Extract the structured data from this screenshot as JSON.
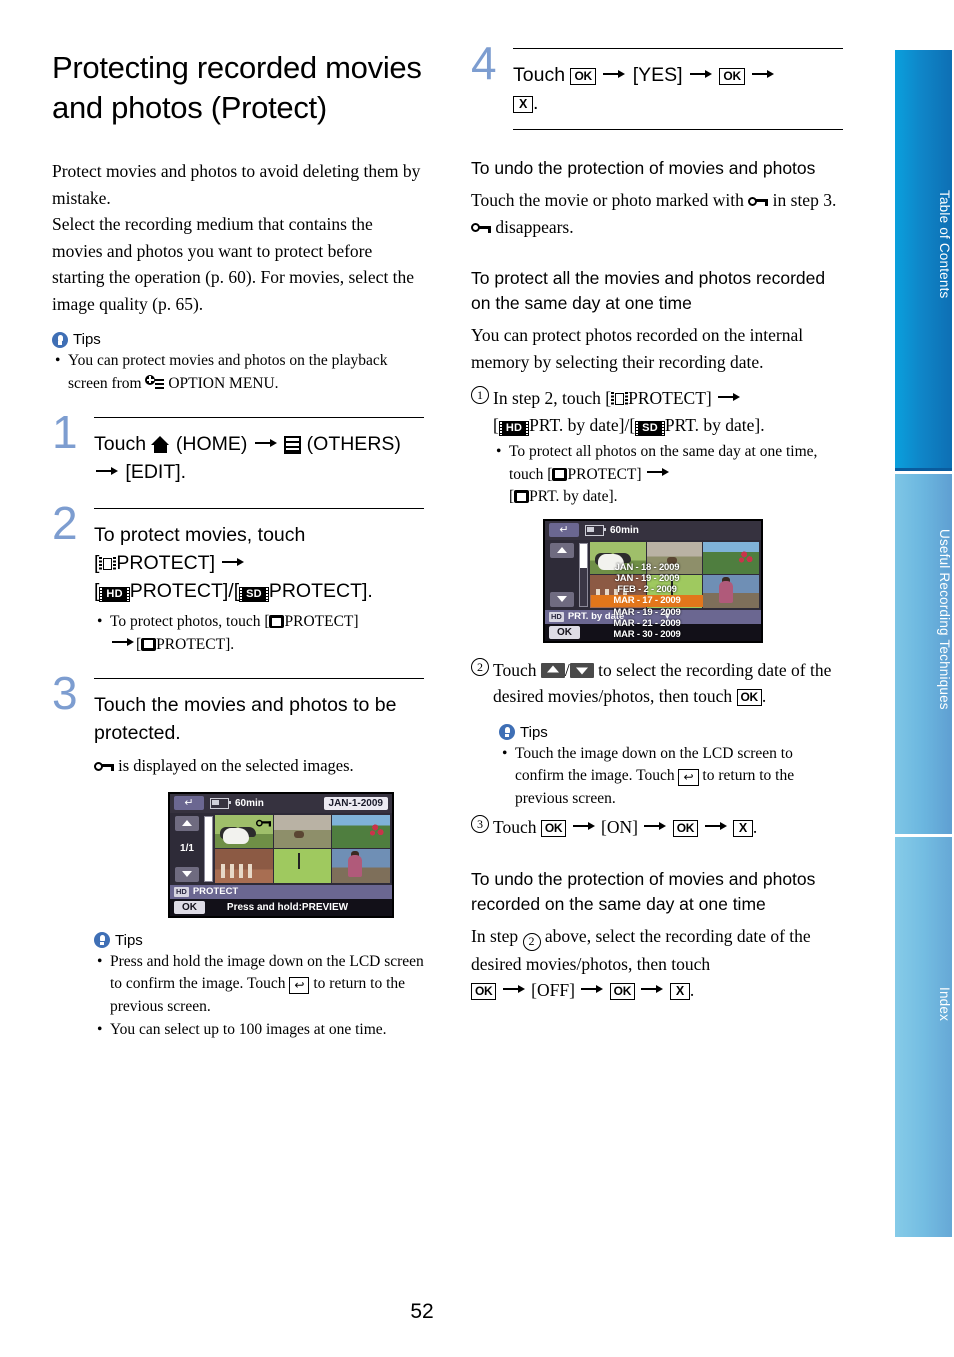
{
  "page": {
    "number": "52",
    "title": "Protecting recorded movies and photos (Protect)"
  },
  "left_column": {
    "intro": {
      "paragraph_1": "Protect movies and photos to avoid deleting them by mistake.",
      "paragraph_2": "Select the recording medium that contains the movies and photos you want to protect before starting the operation (p. 60). For movies, select the image quality (p. 65)."
    },
    "tips_top": {
      "label": "Tips",
      "items": [
        {
          "before": "You can protect movies and photos on the playback screen from",
          "icon": "option-menu-icon",
          "after": "OPTION MENU."
        }
      ]
    },
    "steps": [
      {
        "number": "1",
        "text_parts": {
          "touch": "Touch",
          "home_label": "(HOME)",
          "others_label": "(OTHERS)",
          "edit": "[EDIT]."
        }
      },
      {
        "number": "2",
        "text_parts": {
          "lead": "To protect movies, touch",
          "bracket_open": "[",
          "protect_1": "PROTECT]",
          "hd_badge": "HD",
          "protect_hd": "PROTECT]/[",
          "sd_badge": "SD",
          "protect_sd": "PROTECT]."
        },
        "sub_bullets": [
          {
            "text_a": "To protect photos, touch [",
            "text_b": "PROTECT]",
            "text_c": "[",
            "text_d": "PROTECT]."
          }
        ]
      },
      {
        "number": "3",
        "text": "Touch the movies and photos to be protected.",
        "note_after_icon": "is displayed on the selected images."
      }
    ],
    "lcd_screen_1": {
      "back_icon": "back-arrow-icon",
      "battery_time": "60min",
      "date_pill": "JAN-1-2009",
      "page_indicator": "1/1",
      "status_badge": "HD",
      "status_label": "PROTECT",
      "ok_label": "OK",
      "hint": "Press and hold:PREVIEW",
      "protect_mark": "key-icon"
    },
    "tips_bottom": {
      "label": "Tips",
      "items": [
        {
          "text_a": "Press and hold the image down on the LCD screen to confirm the image. Touch",
          "text_b": "to return to the previous screen."
        },
        {
          "text_a": "You can select up to 100 images at one time.",
          "text_b": ""
        }
      ]
    }
  },
  "right_column": {
    "step_4": {
      "number": "4",
      "touch": "Touch",
      "ok_1": "OK",
      "yes": "[YES]",
      "ok_2": "OK",
      "close": "X",
      "period": "."
    },
    "undo_section": {
      "heading": "To undo the protection of movies and photos",
      "line_1a": "Touch the movie or photo marked with",
      "line_1b": "in step 3.",
      "line_2": "disappears."
    },
    "protect_all_section": {
      "heading": "To protect all the movies and photos recorded on the same day at one time",
      "intro": "You can protect photos recorded on the internal memory by selecting their recording date.",
      "step_1": {
        "marker": "1",
        "text_a": "In step 2, touch [",
        "text_b": "PROTECT]",
        "text_c": "[",
        "hd_badge": "HD",
        "text_d": "PRT. by date]/[",
        "sd_badge": "SD",
        "text_e": "PRT. by date].",
        "sub_bullet": {
          "text_a": "To protect all photos on the same day at one time, touch [",
          "text_b": "PROTECT]",
          "text_c": "[",
          "text_d": "PRT. by date]."
        }
      },
      "lcd_screen_2": {
        "back_icon": "back-arrow-icon",
        "battery_time": "60min",
        "status_badge": "HD",
        "status_label": "PRT. by date",
        "ok_label": "OK",
        "dates": [
          {
            "label": "JAN - 18 - 2009",
            "selected": false
          },
          {
            "label": "JAN - 19 - 2009",
            "selected": false
          },
          {
            "label": "FEB -  2 - 2009",
            "selected": false
          },
          {
            "label": "MAR - 17 - 2009",
            "selected": true
          },
          {
            "label": "MAR - 19 - 2009",
            "selected": false
          },
          {
            "label": "MAR - 21 - 2009",
            "selected": false
          },
          {
            "label": "MAR - 30 - 2009",
            "selected": false
          }
        ]
      },
      "step_2": {
        "marker": "2",
        "text_a": "Touch",
        "text_b": "to select the recording date of the desired movies/photos, then touch",
        "ok_label": "OK",
        "period": "."
      },
      "tips": {
        "label": "Tips",
        "item": {
          "text_a": "Touch the image down on the LCD screen to confirm the image. Touch",
          "text_b": "to return to the previous screen."
        }
      },
      "step_3": {
        "marker": "3",
        "touch": "Touch",
        "ok_1": "OK",
        "on": "[ON]",
        "ok_2": "OK",
        "close": "X",
        "period": "."
      }
    },
    "undo_all_section": {
      "heading": "To undo the protection of movies and photos recorded on the same day at one time",
      "text_a": "In step",
      "marker": "2",
      "text_b": "above, select the recording date of the desired movies/photos, then touch",
      "ok_1": "OK",
      "off": "[OFF]",
      "ok_2": "OK",
      "close": "X",
      "period": "."
    }
  },
  "side_tabs": [
    {
      "label": "Table of Contents",
      "active": true,
      "color": "#0e7fc2"
    },
    {
      "label": "Useful Recording Techniques",
      "active": false,
      "color": "#6bb6df"
    },
    {
      "label": "Index",
      "active": false,
      "color": "#74bde2"
    }
  ]
}
